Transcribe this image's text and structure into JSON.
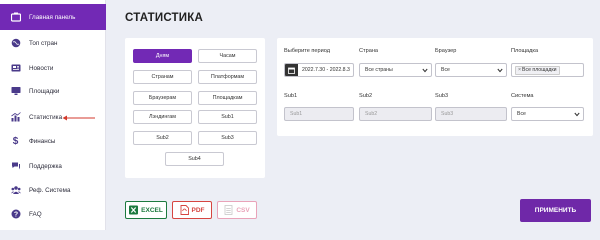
{
  "sidebar": {
    "items": [
      {
        "label": "Главная панель",
        "icon": "dashboard-icon"
      },
      {
        "label": "Топ стран",
        "icon": "globe-icon"
      },
      {
        "label": "Новости",
        "icon": "news-icon"
      },
      {
        "label": "Площадки",
        "icon": "monitor-icon"
      },
      {
        "label": "Статистика",
        "icon": "chart-icon"
      },
      {
        "label": "Финансы",
        "icon": "dollar-icon"
      },
      {
        "label": "Поддержка",
        "icon": "chat-icon"
      },
      {
        "label": "Реф. Система",
        "icon": "users-icon"
      },
      {
        "label": "FAQ",
        "icon": "question-icon"
      }
    ],
    "active_index": 0
  },
  "page": {
    "title": "СТАТИСТИКА"
  },
  "groupings": {
    "items": [
      "Дням",
      "Часам",
      "Странам",
      "Платформам",
      "Браузерам",
      "Площадкам",
      "Лэндингам",
      "Sub1",
      "Sub2",
      "Sub3",
      "Sub4"
    ],
    "active_index": 0
  },
  "filters": {
    "period_label": "Выберите период",
    "period_value": "2022.7.30 - 2022.8.3",
    "country_label": "Страна",
    "country_value": "Все страны",
    "browser_label": "Браузер",
    "browser_value": "Все",
    "platform_label": "Площадка",
    "platform_tag": "Все площадки",
    "platform_tag_remove": "×",
    "sub1_label": "Sub1",
    "sub1_placeholder": "Sub1",
    "sub2_label": "Sub2",
    "sub2_placeholder": "Sub2",
    "sub3_label": "Sub3",
    "sub3_placeholder": "Sub3",
    "system_label": "Система",
    "system_value": "Все"
  },
  "export": {
    "excel": "EXCEL",
    "pdf": "PDF",
    "csv": "CSV"
  },
  "actions": {
    "apply": "ПРИМЕНИТЬ"
  },
  "colors": {
    "accent": "#7229b5",
    "excel": "#1d7a3f",
    "pdf": "#d64541",
    "csv": "#e9a3b9",
    "arrow": "#d33a2c"
  }
}
